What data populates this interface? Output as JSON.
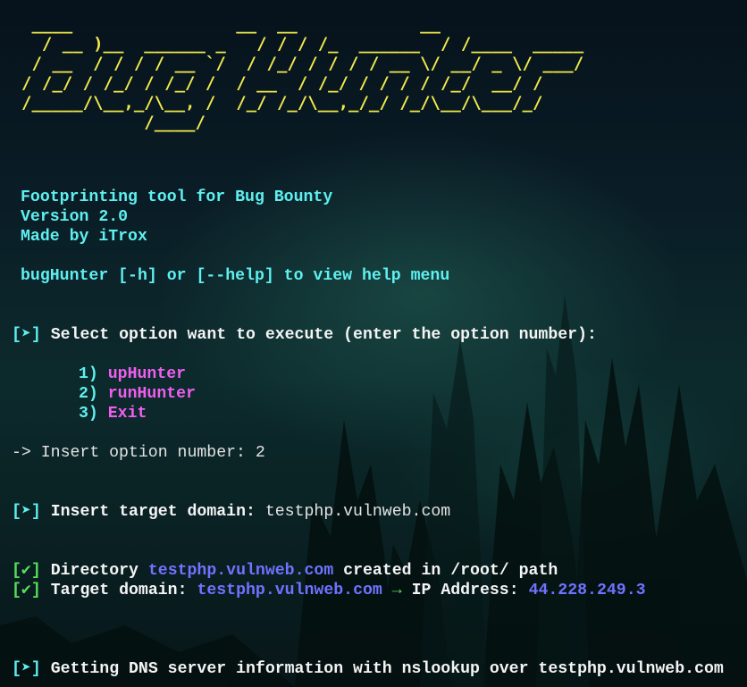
{
  "banner_ascii": " ____                __  __            __\n  / __ )__  ______ _   / / / /_  ______  / /____  _____\n / __  / / / / __ `/  / /_/ / / / / __ \\/ __/ _ \\/ ___/\n/ /_/ / /_/ / /_/ /  / __  / /_/ / / / / /_/  __/ /\n/_____/\\__,_/\\__, /  /_/ /_/\\__,_/_/ /_/\\__/\\___/_/\n            /____/",
  "info": {
    "description": "Footprinting tool for Bug Bounty",
    "version": "Version 2.0",
    "author": "Made by iTrox",
    "help_hint": "bugHunter [-h] or [--help] to view help menu"
  },
  "menu": {
    "prompt_marker": "[➤]",
    "prompt_text": "Select option want to execute (enter the option number):",
    "options": [
      {
        "num": "1)",
        "label": "upHunter"
      },
      {
        "num": "2)",
        "label": "runHunter"
      },
      {
        "num": "3)",
        "label": "Exit"
      }
    ],
    "input_label": "-> Insert option number: ",
    "input_value": "2"
  },
  "target": {
    "marker": "[➤]",
    "label": "Insert target domain:",
    "value": "testphp.vulnweb.com"
  },
  "results": {
    "check_marker": "[✔]",
    "dir_label": "Directory",
    "dir_domain": "testphp.vulnweb.com",
    "dir_suffix": "created in /root/ path",
    "target_label": "Target domain:",
    "target_domain": "testphp.vulnweb.com",
    "arrow": "→",
    "ip_label": "IP Address:",
    "ip_value": "44.228.249.3"
  },
  "dns": {
    "marker": "[➤]",
    "text": "Getting DNS server information with nslookup over testphp.vulnweb.com"
  },
  "colors": {
    "banner": "#f2ea4c",
    "cyan": "#5ef0f0",
    "magenta": "#f05ef0",
    "blue": "#6f73ff",
    "green": "#57e05a"
  }
}
